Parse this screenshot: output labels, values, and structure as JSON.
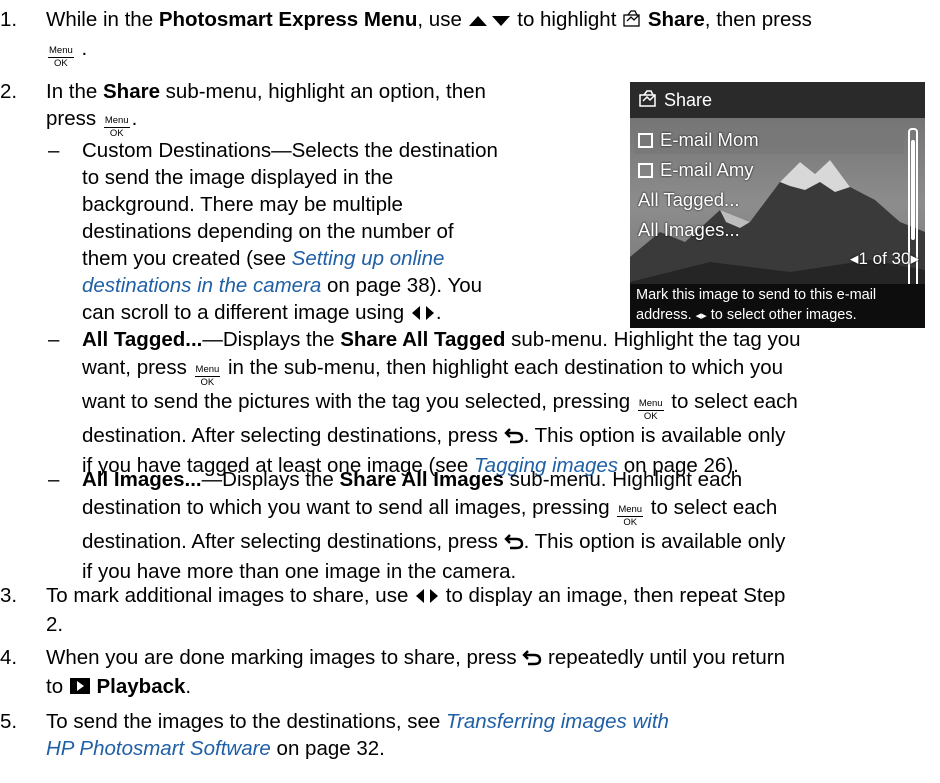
{
  "steps": [
    {
      "number": "1.",
      "p1": "While in the ",
      "b1": "Photosmart Express Menu",
      "p2": ", use ",
      "p3": " to highlight ",
      "b2": "Share",
      "p4": ", then press",
      "icon_updown": "up-down-arrow-icon",
      "icon_share": "share-icon"
    },
    {
      "number": "2.",
      "p1": "In the ",
      "b1": "Share",
      "p2": " sub-menu, highlight an option, then",
      "p3": "press ",
      "p4": "."
    },
    {
      "number": "3.",
      "p1": "To mark additional images to share, use ",
      "p2": " to display an image, then repeat Step",
      "p3": "2."
    },
    {
      "number": "4.",
      "p1": "When you are done marking images to share, press ",
      "p2": " repeatedly until you return",
      "p3": "to ",
      "b1": "Playback",
      "p4": "."
    },
    {
      "number": "5.",
      "p1": "To send the images to the destinations, see ",
      "link1": "Transferring images with",
      "link2": "HP Photosmart Software",
      "p2": " on page 32."
    }
  ],
  "menu_ok": {
    "top": "Menu",
    "bottom": "OK"
  },
  "dash": "–",
  "custom": {
    "l1": "Custom Destinations—Selects the destination",
    "l2": "to send the image displayed in the",
    "l3": "background. There may be multiple",
    "l4": "destinations depending on the number of",
    "l5a": "them you created (see ",
    "l5link": "Setting up online",
    "l6link": "destinations in the camera",
    "l6b": " on page 38). You",
    "l7": "can scroll to a different image using "
  },
  "all_tagged": {
    "b1": "All Tagged...",
    "p1": "—Displays the ",
    "b2": "Share All Tagged",
    "p2": " sub-menu. Highlight the tag you",
    "l2a": "want, press ",
    "l2b": " in the sub-menu, then highlight each destination to which you",
    "l3a": "want to send the pictures with the tag you selected, pressing ",
    "l3b": " to select each",
    "l4a": "destination. After selecting destinations, press ",
    "l4b": ". This option is available only",
    "l5a": "if you have tagged at least one image (see ",
    "l5link": "Tagging images",
    "l5b": " on page 26)."
  },
  "all_images": {
    "b1": "All Images...",
    "p1": "—Displays the ",
    "b2": "Share All Images",
    "p2": " sub-menu. Highlight each",
    "l2a": "destination to which you want to send all images, pressing ",
    "l2b": " to select each",
    "l3a": "destination. After selecting destinations, press ",
    "l3b": ". This option is available only",
    "l4": "if you have more than one image in the camera."
  },
  "camera_screen": {
    "title": "Share",
    "items": [
      {
        "label": "E-mail Mom",
        "checkbox": true,
        "selected": true
      },
      {
        "label": "E-mail Amy",
        "checkbox": true,
        "selected": false
      },
      {
        "label": "All Tagged...",
        "checkbox": false,
        "selected": false
      },
      {
        "label": "All Images...",
        "checkbox": false,
        "selected": false
      }
    ],
    "counter": "1 of 30",
    "help": "Mark this image to send to this e-mail address.  to select other images."
  },
  "help_line1": "Mark this image to send to this e-mail",
  "help_line2a": "address. ",
  "help_line2b": " to select other images.",
  "colors": {
    "link": "#1f5fa5",
    "lcd_background": "#1b1b1b",
    "lcd_selection": "#787878"
  }
}
